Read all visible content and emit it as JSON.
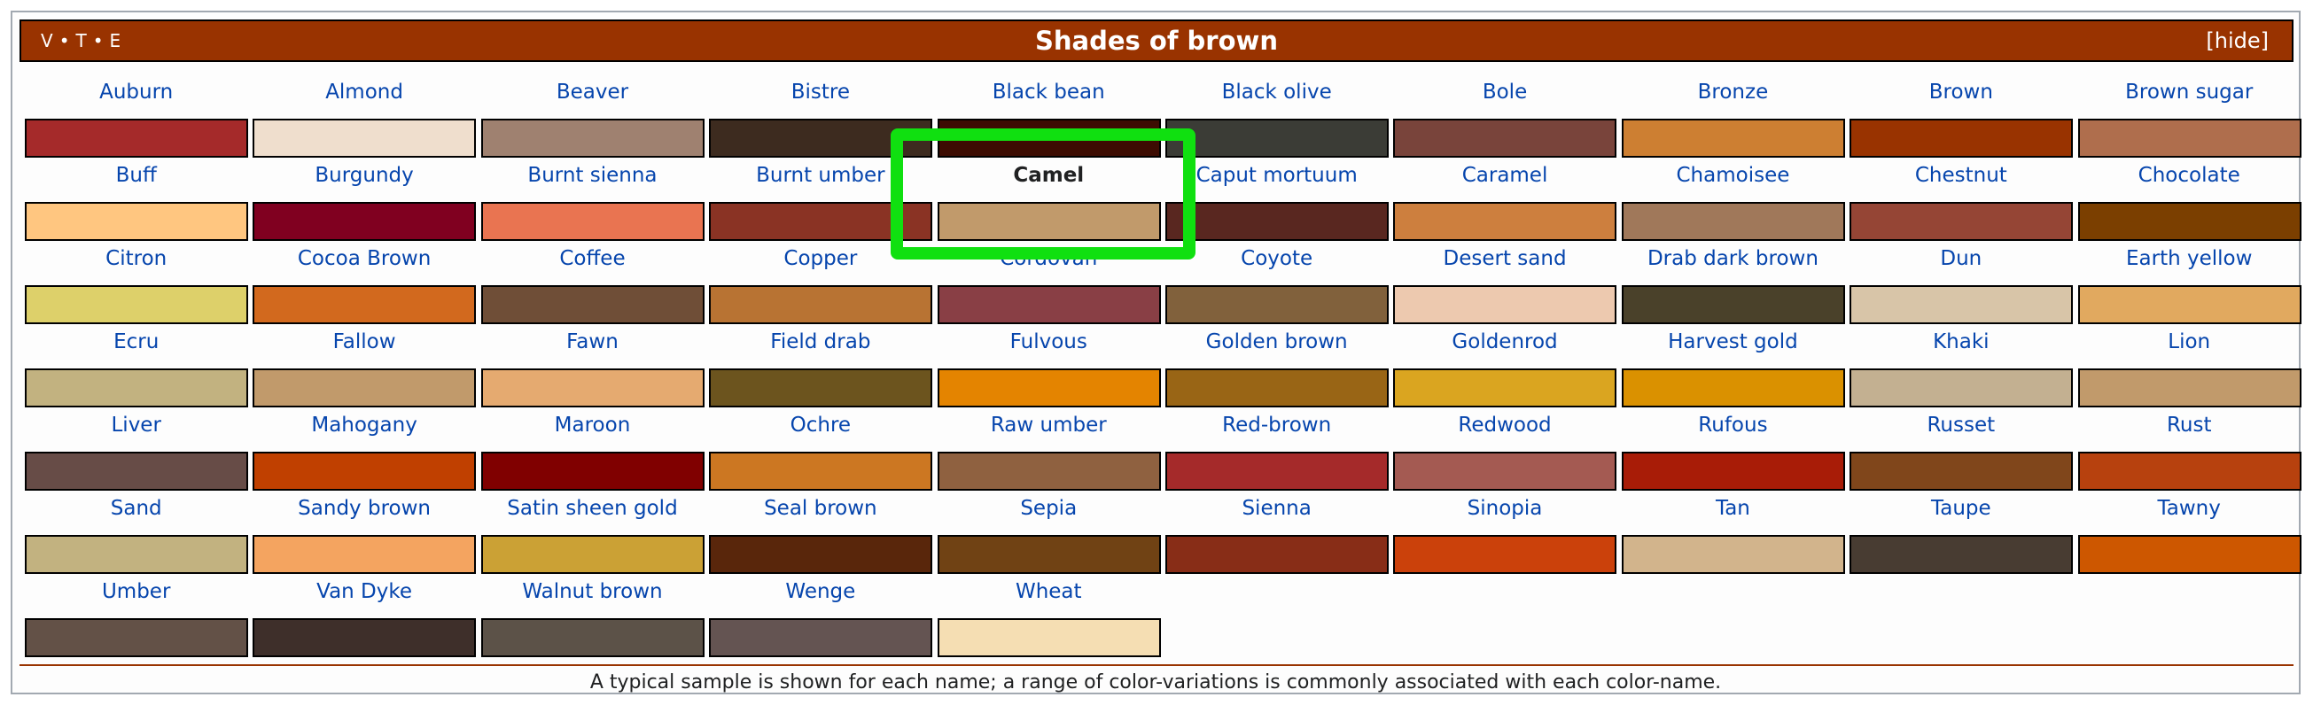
{
  "header": {
    "vte": [
      "V",
      "T",
      "E"
    ],
    "title": "Shades of brown",
    "hide_label": "[hide]"
  },
  "colors": {
    "titlebar_bg": "#993300",
    "link": "#0645ad",
    "highlight": "#10e010"
  },
  "current_item": "Camel",
  "items": [
    {
      "name": "Auburn",
      "color": "#a52a2a"
    },
    {
      "name": "Almond",
      "color": "#efdecd"
    },
    {
      "name": "Beaver",
      "color": "#9f8170"
    },
    {
      "name": "Bistre",
      "color": "#3d2b1f"
    },
    {
      "name": "Black bean",
      "color": "#3d0c02"
    },
    {
      "name": "Black olive",
      "color": "#3b3c36"
    },
    {
      "name": "Bole",
      "color": "#79443b"
    },
    {
      "name": "Bronze",
      "color": "#cd7f32"
    },
    {
      "name": "Brown",
      "color": "#993300"
    },
    {
      "name": "Brown sugar",
      "color": "#af6e4d"
    },
    {
      "name": "Buff",
      "color": "#ffc680"
    },
    {
      "name": "Burgundy",
      "color": "#800020"
    },
    {
      "name": "Burnt sienna",
      "color": "#e97451"
    },
    {
      "name": "Burnt umber",
      "color": "#8a3324"
    },
    {
      "name": "Camel",
      "color": "#c19a6b"
    },
    {
      "name": "Caput mortuum",
      "color": "#592720"
    },
    {
      "name": "Caramel",
      "color": "#cd7f3e"
    },
    {
      "name": "Chamoisee",
      "color": "#a0785a"
    },
    {
      "name": "Chestnut",
      "color": "#954535"
    },
    {
      "name": "Chocolate",
      "color": "#7b3f00"
    },
    {
      "name": "Citron",
      "color": "#ddd06a"
    },
    {
      "name": "Cocoa Brown",
      "color": "#d2691e"
    },
    {
      "name": "Coffee",
      "color": "#6f4e37"
    },
    {
      "name": "Copper",
      "color": "#b87333"
    },
    {
      "name": "Cordovan",
      "color": "#893f45"
    },
    {
      "name": "Coyote",
      "color": "#81613c"
    },
    {
      "name": "Desert sand",
      "color": "#edc9af"
    },
    {
      "name": "Drab dark brown",
      "color": "#4a412a"
    },
    {
      "name": "Dun",
      "color": "#d8c5a8"
    },
    {
      "name": "Earth yellow",
      "color": "#e1a95f"
    },
    {
      "name": "Ecru",
      "color": "#c2b280"
    },
    {
      "name": "Fallow",
      "color": "#c19a6b"
    },
    {
      "name": "Fawn",
      "color": "#e5aa70"
    },
    {
      "name": "Field drab",
      "color": "#6c541e"
    },
    {
      "name": "Fulvous",
      "color": "#e48400"
    },
    {
      "name": "Golden brown",
      "color": "#996515"
    },
    {
      "name": "Goldenrod",
      "color": "#daa520"
    },
    {
      "name": "Harvest gold",
      "color": "#da9100"
    },
    {
      "name": "Khaki",
      "color": "#c3b091"
    },
    {
      "name": "Lion",
      "color": "#c19a6b"
    },
    {
      "name": "Liver",
      "color": "#674c47"
    },
    {
      "name": "Mahogany",
      "color": "#c04000"
    },
    {
      "name": "Maroon",
      "color": "#800000"
    },
    {
      "name": "Ochre",
      "color": "#cc7722"
    },
    {
      "name": "Raw umber",
      "color": "#8f6140"
    },
    {
      "name": "Red-brown",
      "color": "#a52a2a"
    },
    {
      "name": "Redwood",
      "color": "#a45a52"
    },
    {
      "name": "Rufous",
      "color": "#a81c07"
    },
    {
      "name": "Russet",
      "color": "#80461b"
    },
    {
      "name": "Rust",
      "color": "#b7410e"
    },
    {
      "name": "Sand",
      "color": "#c2b280"
    },
    {
      "name": "Sandy brown",
      "color": "#f4a460"
    },
    {
      "name": "Satin sheen gold",
      "color": "#cba135"
    },
    {
      "name": "Seal brown",
      "color": "#59260b"
    },
    {
      "name": "Sepia",
      "color": "#704214"
    },
    {
      "name": "Sienna",
      "color": "#882d17"
    },
    {
      "name": "Sinopia",
      "color": "#cb410b"
    },
    {
      "name": "Tan",
      "color": "#d2b48c"
    },
    {
      "name": "Taupe",
      "color": "#483c32"
    },
    {
      "name": "Tawny",
      "color": "#cd5700"
    },
    {
      "name": "Umber",
      "color": "#635147"
    },
    {
      "name": "Van Dyke",
      "color": "#3e2f2a"
    },
    {
      "name": "Walnut brown",
      "color": "#5c5248"
    },
    {
      "name": "Wenge",
      "color": "#645452"
    },
    {
      "name": "Wheat",
      "color": "#f5deb3"
    }
  ],
  "footer": "A typical sample is shown for each name; a range of color-variations is commonly associated with each color-name."
}
